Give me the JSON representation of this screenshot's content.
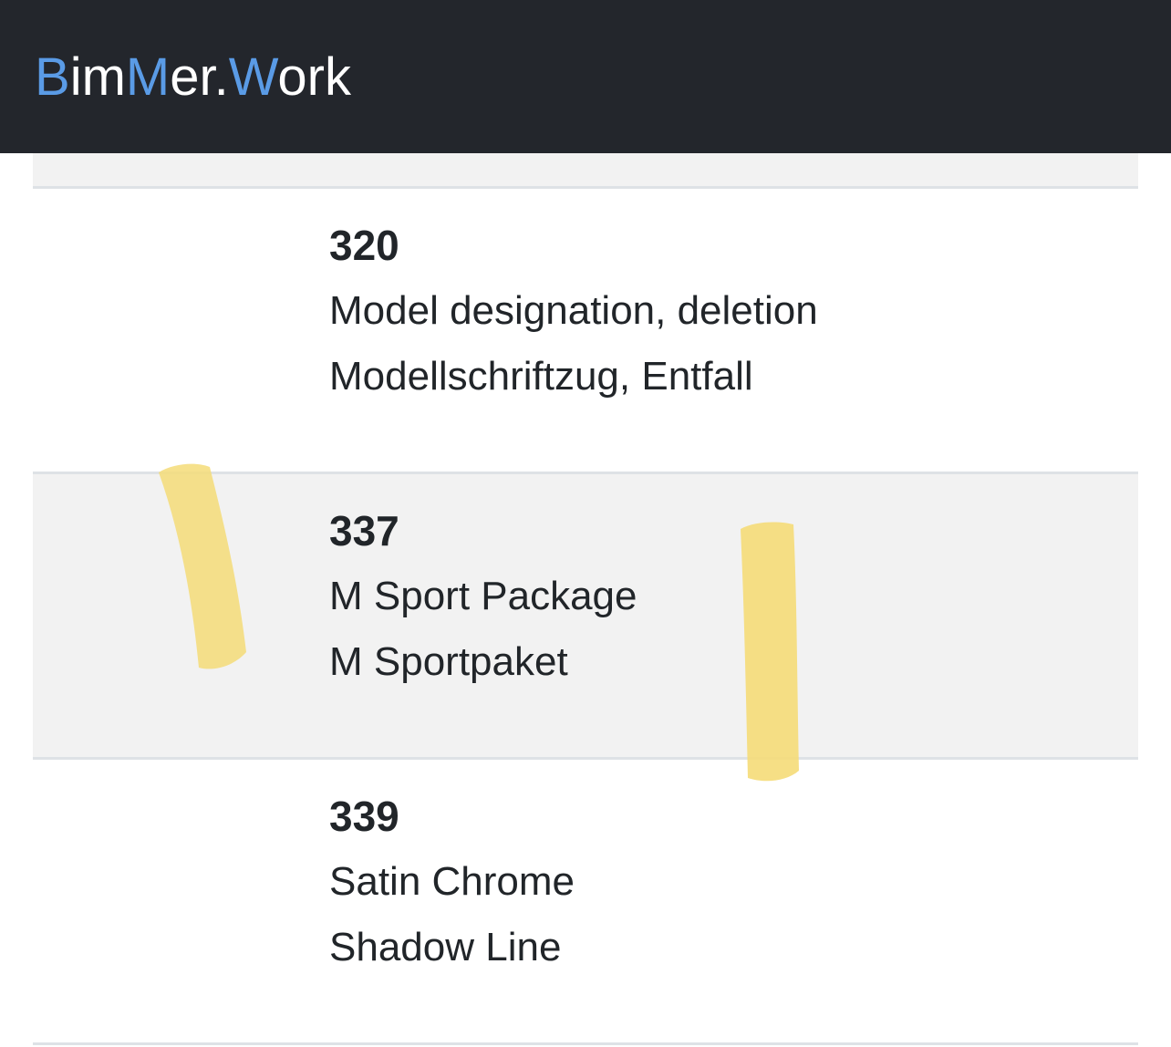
{
  "navbar": {
    "brand_parts": [
      "B",
      "im",
      "M",
      "er.",
      "W",
      "ork"
    ]
  },
  "options": [
    {
      "code": "320",
      "name_en": "Model designation, deletion",
      "name_de": "Modellschriftzug, Entfall"
    },
    {
      "code": "337",
      "name_en": "M Sport Package",
      "name_de": "M Sportpaket"
    },
    {
      "code": "339",
      "name_en": "Satin Chrome",
      "name_de": "Shadow Line"
    }
  ],
  "colors": {
    "navbar_bg": "#23262c",
    "brand_accent": "#5a9be6",
    "stripe_bg": "#f2f2f2",
    "highlighter": "#f5dc78"
  }
}
